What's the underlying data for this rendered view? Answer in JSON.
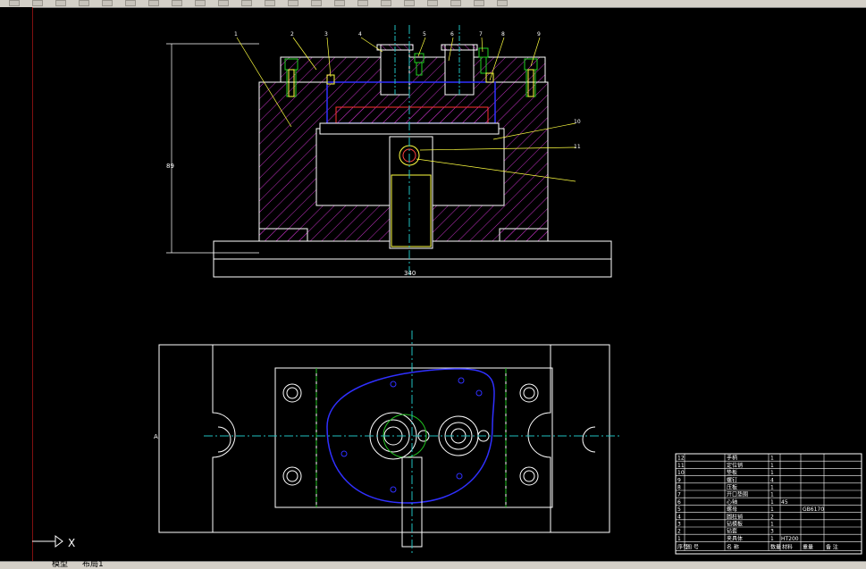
{
  "toolbar": {
    "icons": [
      "new-icon",
      "open-icon",
      "save-icon",
      "print-icon",
      "cut-icon",
      "copy-icon",
      "paste-icon",
      "undo-icon",
      "redo-icon",
      "pan-icon",
      "zoom-icon",
      "zoom-window-icon",
      "zoom-previous-icon",
      "properties-icon",
      "design-center-icon",
      "tool-palette-icon",
      "text-icon",
      "dim-icon",
      "layer-icon",
      "table-icon",
      "block-icon",
      "color-icon"
    ]
  },
  "tabs": {
    "model": "模型",
    "layout": "布局1"
  },
  "ucs": {
    "x_label": "X"
  },
  "drawing": {
    "section_view": {
      "balloons": [
        "1",
        "2",
        "3",
        "4",
        "5",
        "6",
        "7",
        "8",
        "9",
        "10",
        "11"
      ],
      "dim_vertical": "89",
      "dim_horizontal": "340"
    },
    "plan_view": {
      "side_mark": "A"
    }
  },
  "title_block": {
    "rows": [
      {
        "no": "12",
        "name": "手柄",
        "qty": "1",
        "mat": "",
        "note": ""
      },
      {
        "no": "11",
        "name": "定位销",
        "qty": "1",
        "mat": "",
        "note": ""
      },
      {
        "no": "10",
        "name": "垫板",
        "qty": "1",
        "mat": "",
        "note": ""
      },
      {
        "no": "9",
        "name": "螺钉",
        "qty": "4",
        "mat": "",
        "note": ""
      },
      {
        "no": "8",
        "name": "压板",
        "qty": "1",
        "mat": "",
        "note": ""
      },
      {
        "no": "7",
        "name": "开口垫圈",
        "qty": "1",
        "mat": "",
        "note": ""
      },
      {
        "no": "6",
        "name": "心轴",
        "qty": "1",
        "mat": "45",
        "note": ""
      },
      {
        "no": "5",
        "name": "螺母",
        "qty": "1",
        "mat": "",
        "note": "GB6170"
      },
      {
        "no": "4",
        "name": "圆柱销",
        "qty": "2",
        "mat": "",
        "note": ""
      },
      {
        "no": "3",
        "name": "钻模板",
        "qty": "1",
        "mat": "",
        "note": ""
      },
      {
        "no": "2",
        "name": "钻套",
        "qty": "3",
        "mat": "",
        "note": ""
      },
      {
        "no": "1",
        "name": "夹具体",
        "qty": "1",
        "mat": "HT200",
        "note": ""
      }
    ],
    "header": {
      "no": "序号",
      "code": "图 号",
      "name": "名 称",
      "qty": "数量",
      "mat": "材料",
      "weight": "重量",
      "note": "备 注"
    }
  }
}
